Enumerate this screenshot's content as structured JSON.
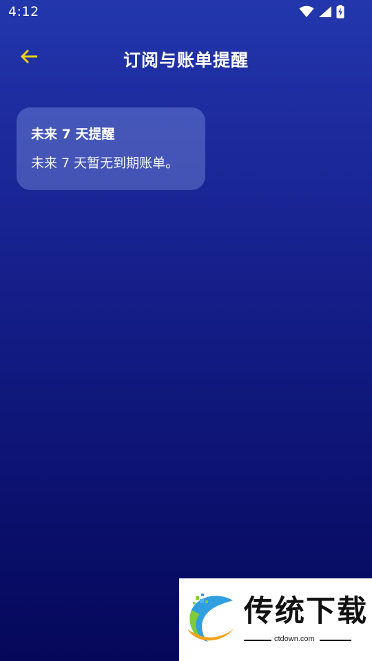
{
  "status_bar": {
    "time": "4:12",
    "icons": [
      "wifi-icon",
      "cellular-signal-icon",
      "battery-charging-icon"
    ]
  },
  "app_bar": {
    "title": "订阅与账单提醒",
    "back_icon": "arrow-left-icon",
    "accent_color": "#e8d21c"
  },
  "reminder_card": {
    "title": "未来 7 天提醒",
    "body": "未来 7 天暂无到期账单。"
  },
  "watermark": {
    "logo_icon": "ctdown-logo-icon",
    "title": "传统下载",
    "url": "ctdown.com"
  },
  "colors": {
    "background_top": "#2337ad",
    "background_bottom": "#05085a",
    "card_background": "rgba(120,140,220,0.45)"
  }
}
